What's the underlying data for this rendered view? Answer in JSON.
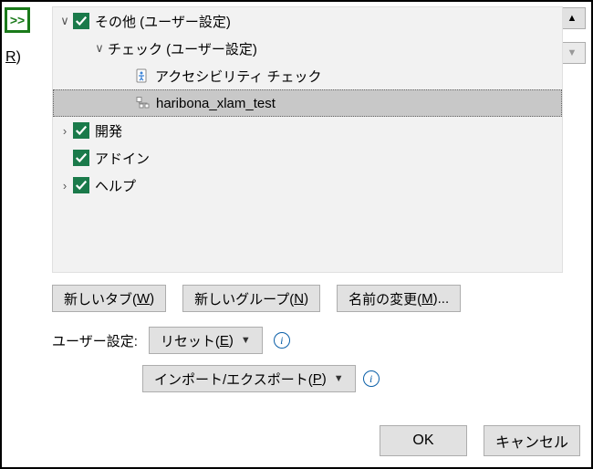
{
  "left": {
    "add": ">>",
    "inc_r": "R"
  },
  "tree": {
    "other": {
      "label": "その他 (ユーザー設定)"
    },
    "check_group": {
      "label": "チェック (ユーザー設定)"
    },
    "access": {
      "label": "アクセシビリティ チェック"
    },
    "haribona": {
      "label": "haribona_xlam_test"
    },
    "dev": {
      "label": "開発"
    },
    "addin": {
      "label": "アドイン"
    },
    "help": {
      "label": "ヘルプ"
    }
  },
  "buttons": {
    "new_tab_pre": "新しいタブ(",
    "new_tab_u": "W",
    "new_tab_post": ")",
    "new_group_pre": "新しいグループ(",
    "new_group_u": "N",
    "new_group_post": ")",
    "rename_pre": "名前の変更(",
    "rename_u": "M",
    "rename_post": ")..."
  },
  "settings": {
    "label": "ユーザー設定:",
    "reset_pre": "リセット(",
    "reset_u": "E",
    "reset_post": ")",
    "impexp_pre": "インポート/エクスポート(",
    "impexp_u": "P",
    "impexp_post": ")"
  },
  "footer": {
    "ok": "OK",
    "cancel": "キャンセル"
  }
}
